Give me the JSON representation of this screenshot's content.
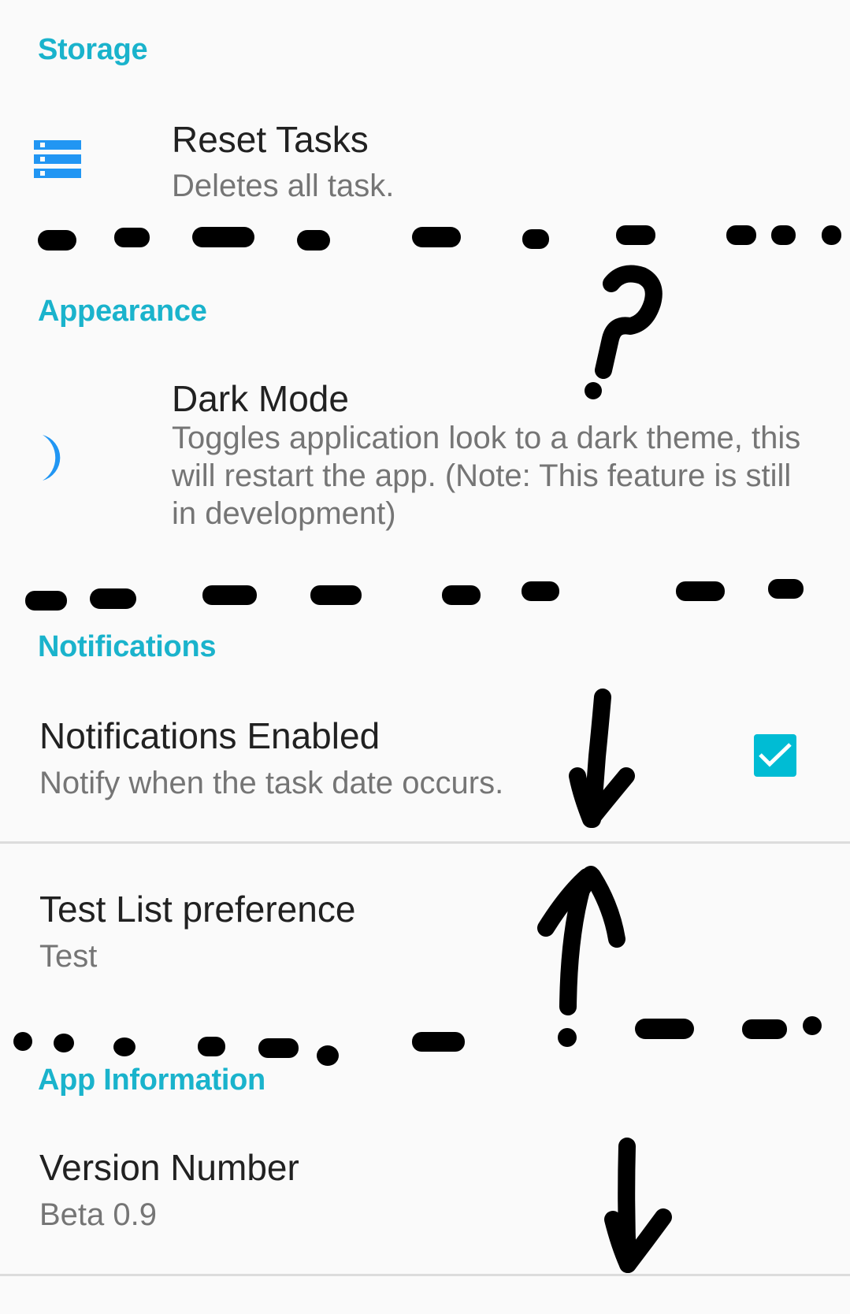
{
  "colors": {
    "accent": "#1ab3cc",
    "icon_blue": "#2196f3",
    "checkbox": "#00bcd4",
    "title_text": "#212121",
    "subtitle_text": "#757575",
    "background": "#fafafa",
    "annotation_ink": "#000000"
  },
  "sections": {
    "storage": {
      "header": "Storage",
      "items": [
        {
          "icon": "storage-icon",
          "title": "Reset Tasks",
          "summary": "Deletes all task."
        }
      ]
    },
    "appearance": {
      "header": "Appearance",
      "items": [
        {
          "icon": "moon-icon",
          "title": "Dark Mode",
          "summary": "Toggles application look to a dark theme, this will restart the app. (Note: This feature is still in development)"
        }
      ]
    },
    "notifications": {
      "header": "Notifications",
      "items": [
        {
          "title": "Notifications Enabled",
          "summary": "Notify when the task date occurs.",
          "checked": true
        },
        {
          "title": "Test List preference",
          "summary": "Test"
        }
      ]
    },
    "app_information": {
      "header": "App Information",
      "items": [
        {
          "title": "Version Number",
          "summary": "Beta 0.9"
        }
      ]
    }
  },
  "annotations": {
    "marks": [
      "dashed-line",
      "question-mark",
      "dashed-line",
      "down-arrow",
      "up-arrow",
      "dashed-line",
      "down-arrow"
    ]
  }
}
